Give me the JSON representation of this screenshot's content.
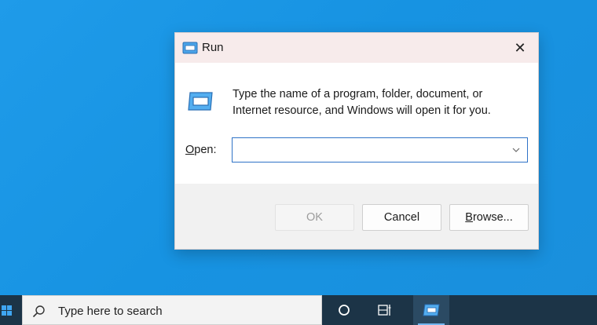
{
  "dialog": {
    "title": "Run",
    "close_symbol": "✕",
    "message": "Type the name of a program, folder, document, or Internet resource, and Windows will open it for you.",
    "open_label_key": "O",
    "open_label_rest": "pen:",
    "open_value": "",
    "buttons": {
      "ok": "OK",
      "cancel": "Cancel",
      "browse_key": "B",
      "browse_rest": "rowse..."
    },
    "icons": {
      "title_icon": "run-icon",
      "main_icon": "run-icon",
      "dropdown_icon": "chevron-down-icon",
      "close_icon": "close-icon"
    }
  },
  "taskbar": {
    "search_placeholder": "Type here to search",
    "icons": {
      "start": "windows-start-icon",
      "search": "search-icon",
      "cortana": "cortana-circle-icon",
      "task_view": "task-view-icon",
      "run_app": "run-app-icon"
    }
  },
  "colors": {
    "desktop_bg": "#1a94e3",
    "taskbar_bg": "#1c3447",
    "accent": "#2f73c7",
    "titlebar_bg": "#f7ebeb",
    "footer_bg": "#f1f1f1"
  }
}
